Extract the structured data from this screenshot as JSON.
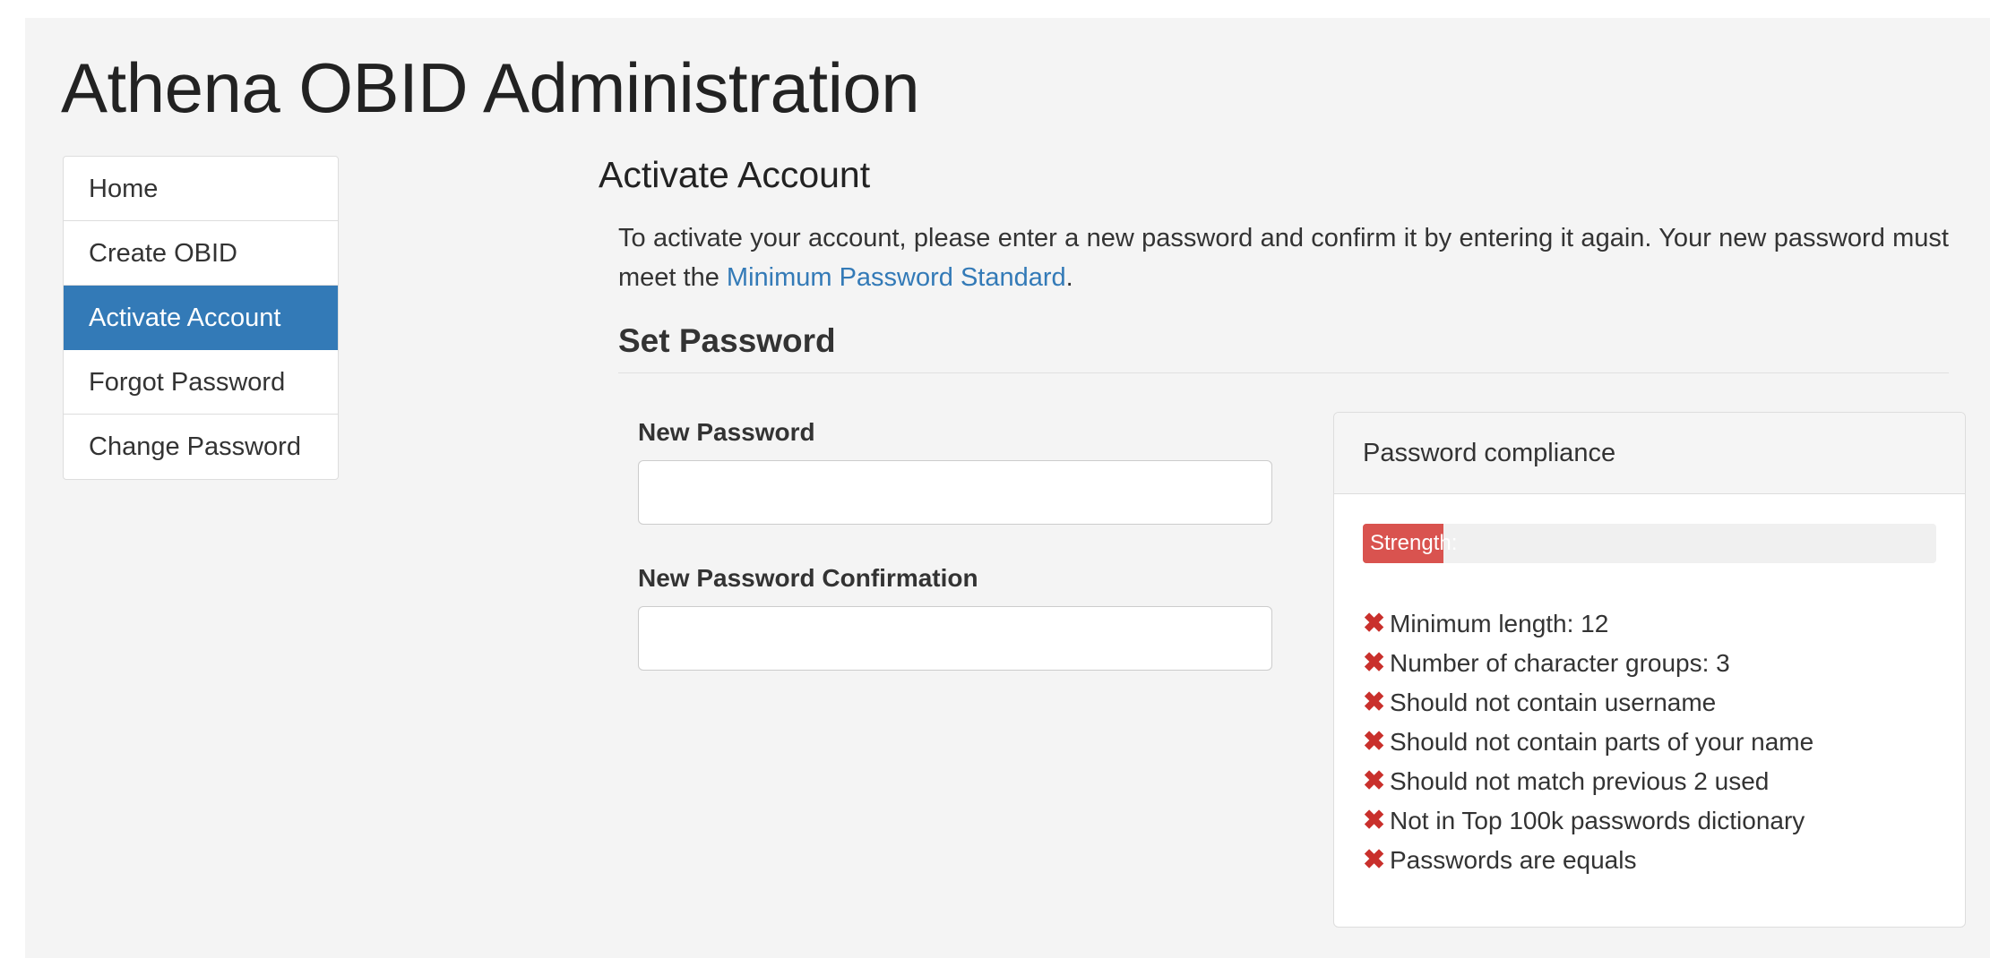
{
  "app": {
    "title": "Athena OBID Administration"
  },
  "sidebar": {
    "items": [
      {
        "label": "Home",
        "active": false
      },
      {
        "label": "Create OBID",
        "active": false
      },
      {
        "label": "Activate Account",
        "active": true
      },
      {
        "label": "Forgot Password",
        "active": false
      },
      {
        "label": "Change Password",
        "active": false
      }
    ]
  },
  "main": {
    "title": "Activate Account",
    "intro_text": "To activate your account, please enter a new password and confirm it by entering it again. Your new password must meet the ",
    "intro_link": "Minimum Password Standard",
    "intro_end": ".",
    "section_title": "Set Password",
    "new_password": {
      "label": "New Password",
      "value": "",
      "placeholder": ""
    },
    "confirm_password": {
      "label": "New Password Confirmation",
      "value": "",
      "placeholder": ""
    }
  },
  "compliance": {
    "heading": "Password compliance",
    "strength_label": "Strength:",
    "strength_fraction": 0.14,
    "status_color": "#d9534f",
    "fail_icon": "x-mark-icon",
    "rules": [
      "Minimum length: 12",
      "Number of character groups: 3",
      "Should not contain username",
      "Should not contain parts of your name",
      "Should not match previous 2 used",
      "Not in Top 100k passwords dictionary",
      "Passwords are equals"
    ]
  },
  "colors": {
    "accent": "#337ab7",
    "danger": "#d9534f",
    "background": "#f4f4f4"
  }
}
